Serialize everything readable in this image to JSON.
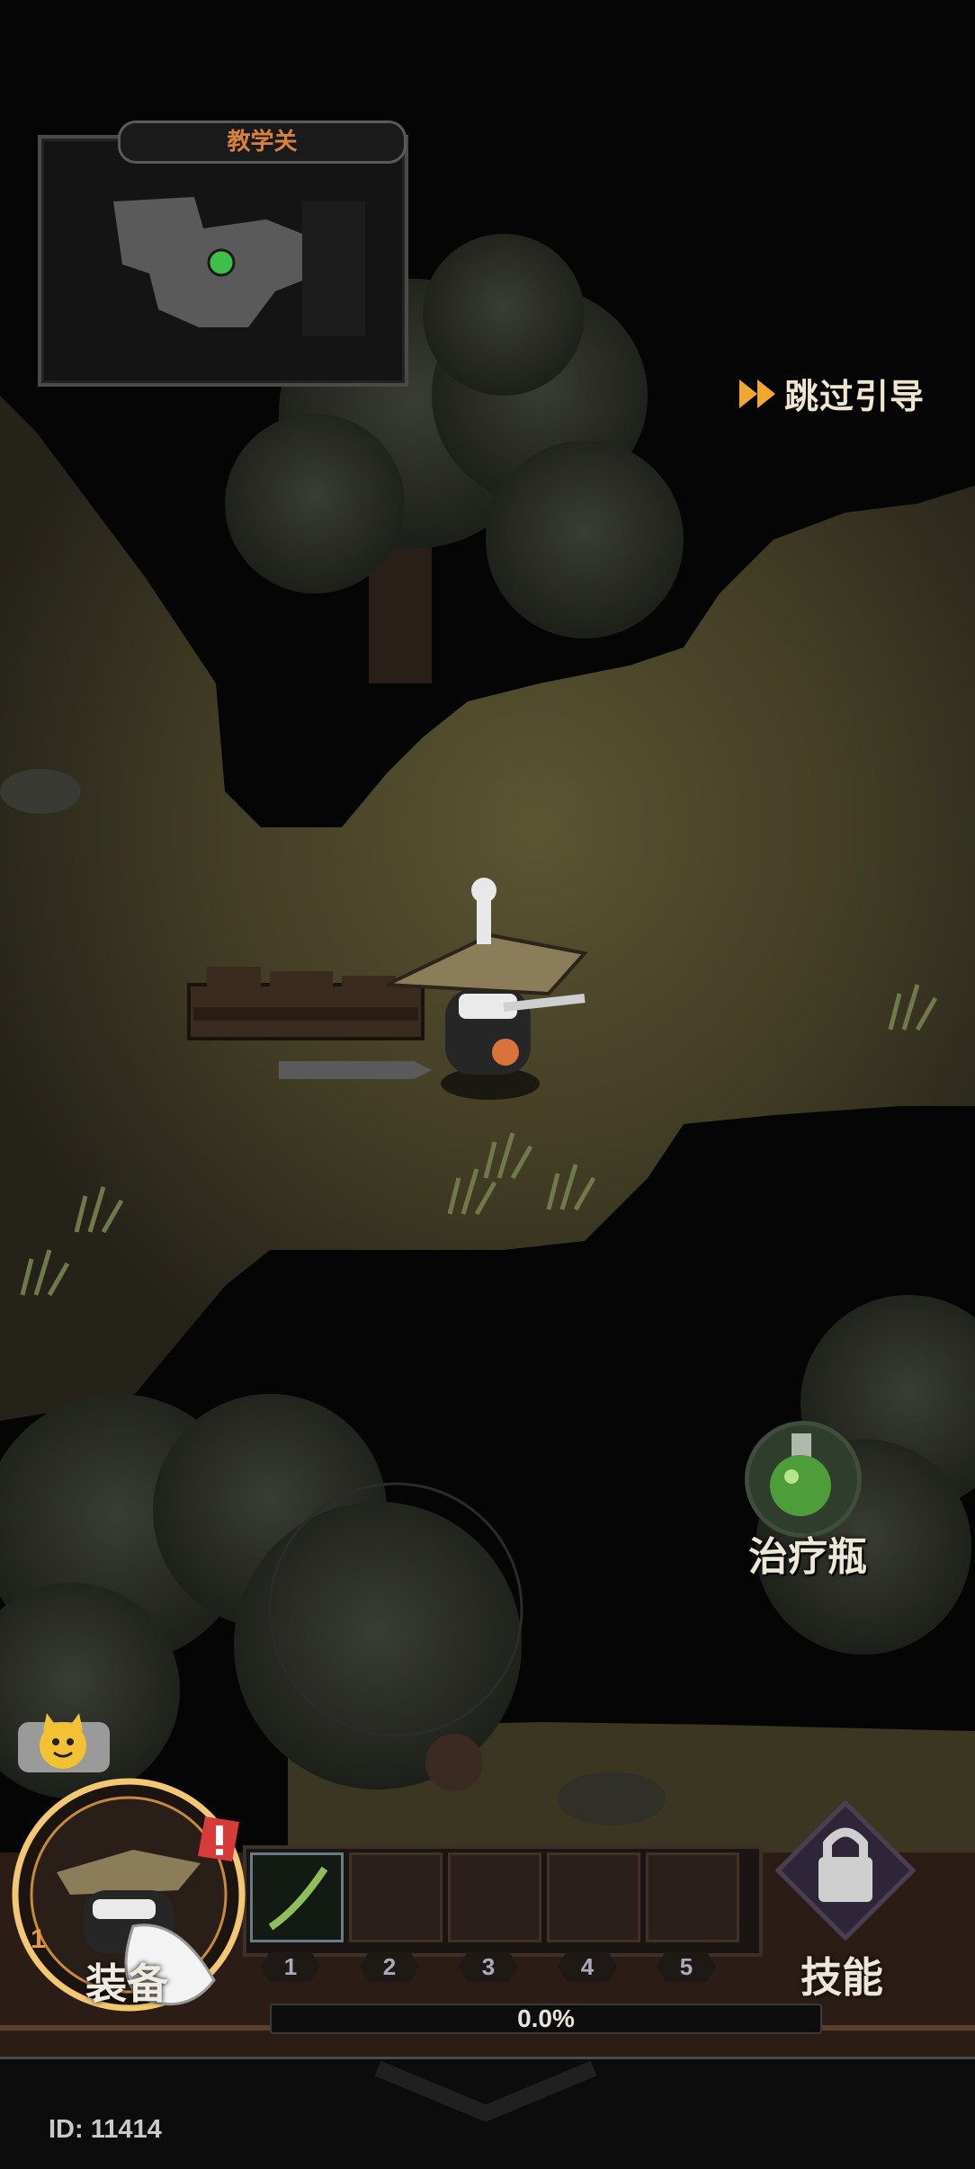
{
  "minimap": {
    "title": "教学关",
    "player_marker_color": "#3fbf4a"
  },
  "skip_guide": {
    "label": "跳过引导",
    "icon": "fast-forward-icon",
    "icon_color": "#f0a830"
  },
  "potion": {
    "label": "治疗瓶",
    "icon": "green-potion-flask-icon"
  },
  "hud": {
    "equip_label": "装备",
    "equip_level": "1",
    "skill_label": "技能",
    "skill_icon": "lock-icon",
    "slot_numbers": [
      "1",
      "2",
      "3",
      "4",
      "5"
    ],
    "progress_label": "0.0%",
    "progress_value": 0.0,
    "alert_icon": "exclamation-badge-icon",
    "emote_icon": "cat-face-emote-icon"
  },
  "player_id": "ID: 11414"
}
